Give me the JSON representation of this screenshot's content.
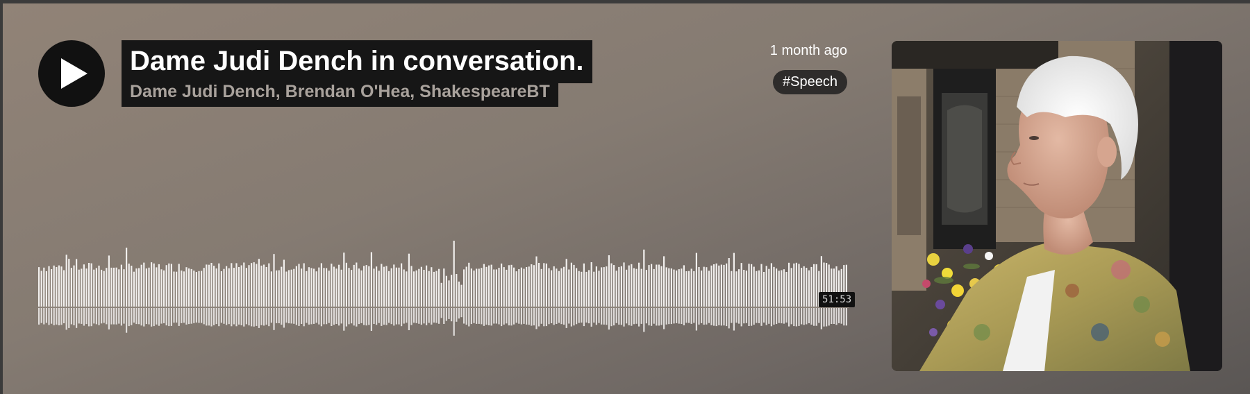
{
  "track": {
    "title": "Dame Judi Dench in conversation.",
    "artist": "Dame Judi Dench, Brendan O'Hea, ShakespeareBT",
    "posted": "1 month ago",
    "tag": "Speech",
    "tag_prefix": "#",
    "duration": "51:53"
  },
  "controls": {
    "play_icon": "play-icon"
  },
  "artwork": {
    "subject": "portrait of a woman with short white hair in a floral jacket, church interior with flowers"
  },
  "colors": {
    "background_light": "#918377",
    "background_dark": "#5a5654",
    "waveform": "#f2f0ee",
    "label_background": "#161616"
  }
}
